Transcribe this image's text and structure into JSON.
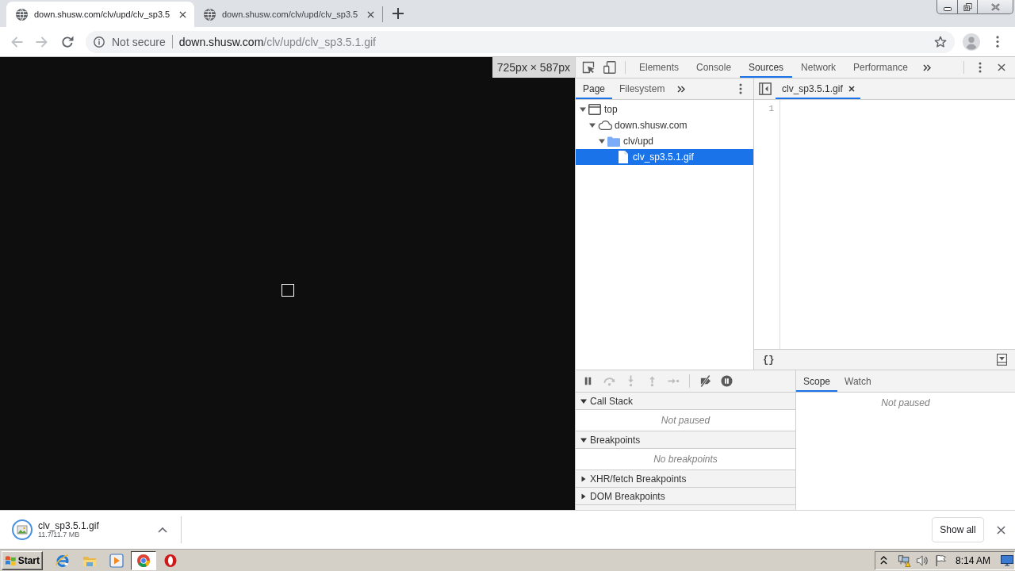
{
  "browser": {
    "tabs": [
      {
        "title": "down.shusw.com/clv/upd/clv_sp3.5",
        "selected": true
      },
      {
        "title": "down.shusw.com/clv/upd/clv_sp3.5",
        "selected": false
      }
    ],
    "navigation": [
      {
        "kind": "back",
        "disabled": true
      },
      {
        "kind": "forward",
        "disabled": true
      },
      {
        "kind": "reload",
        "disabled": false
      }
    ],
    "address_bar": {
      "security": "Not secure",
      "host": "down.shusw.com",
      "path": "/clv/upd/clv_sp3.5.1.gif"
    }
  },
  "viewport": {
    "size_label": "725px × 587px"
  },
  "devtools": {
    "tabs": [
      {
        "label": "Elements",
        "selected": false
      },
      {
        "label": "Console",
        "selected": false
      },
      {
        "label": "Sources",
        "selected": true
      },
      {
        "label": "Network",
        "selected": false
      },
      {
        "label": "Performance",
        "selected": false
      }
    ],
    "navigator": {
      "tabs": [
        {
          "label": "Page",
          "selected": true
        },
        {
          "label": "Filesystem",
          "selected": false
        }
      ],
      "tree": [
        {
          "label": "top",
          "kind": "frame",
          "expanded": true,
          "selected": false,
          "children": [
            {
              "label": "down.shusw.com",
              "kind": "domain",
              "expanded": true,
              "selected": false,
              "children": [
                {
                  "label": "clv/upd",
                  "kind": "folder",
                  "expanded": true,
                  "selected": false,
                  "children": [
                    {
                      "label": "clv_sp3.5.1.gif",
                      "kind": "file",
                      "selected": true
                    }
                  ]
                }
              ]
            }
          ]
        }
      ]
    },
    "editor": {
      "tabs": [
        {
          "label": "clv_sp3.5.1.gif",
          "selected": true
        }
      ],
      "line_numbers": [
        "1"
      ],
      "format_label": "{}"
    },
    "debugger": {
      "controls": [
        {
          "kind": "pause",
          "disabled": false
        },
        {
          "kind": "step-over",
          "disabled": true
        },
        {
          "kind": "step-into",
          "disabled": true
        },
        {
          "kind": "step-out",
          "disabled": true
        },
        {
          "kind": "step",
          "disabled": true
        },
        {
          "kind": "deactivate",
          "disabled": false
        },
        {
          "kind": "pause-exceptions",
          "disabled": false
        }
      ],
      "sections": [
        {
          "title": "Call Stack",
          "expanded": true,
          "message": "Not paused"
        },
        {
          "title": "Breakpoints",
          "expanded": true,
          "message": "No breakpoints"
        },
        {
          "title": "XHR/fetch Breakpoints",
          "expanded": false
        },
        {
          "title": "DOM Breakpoints",
          "expanded": false
        }
      ],
      "sidebar": {
        "tabs": [
          {
            "label": "Scope",
            "selected": true
          },
          {
            "label": "Watch",
            "selected": false
          }
        ],
        "message": "Not paused"
      }
    }
  },
  "downloads": {
    "items": [
      {
        "name": "clv_sp3.5.1.gif",
        "size": "11.7/11.7 MB"
      }
    ],
    "show_all": "Show all"
  },
  "taskbar": {
    "start": "Start",
    "apps": [
      {
        "kind": "e-logo",
        "selected": false
      },
      {
        "kind": "folder",
        "selected": false
      },
      {
        "kind": "player",
        "selected": false
      },
      {
        "kind": "round-logo",
        "selected": true
      },
      {
        "kind": "o-logo",
        "selected": false
      }
    ],
    "clock": "8:14 AM"
  }
}
